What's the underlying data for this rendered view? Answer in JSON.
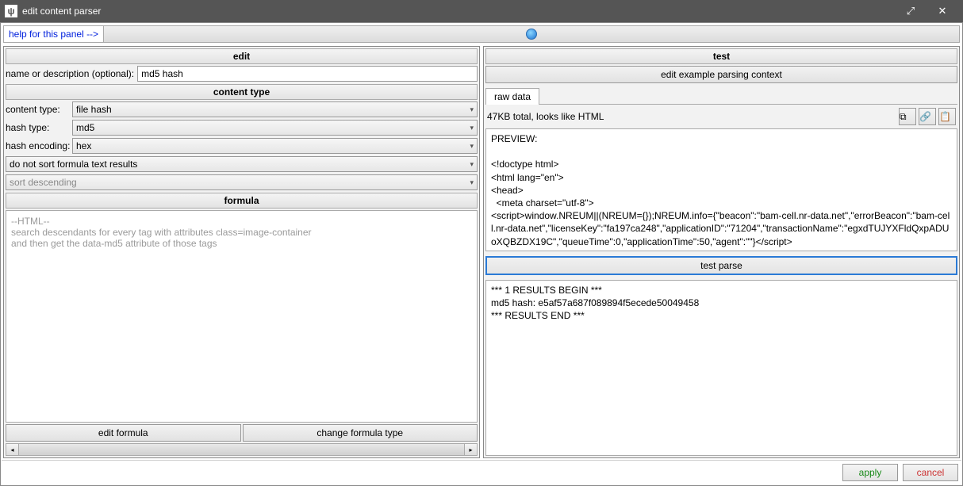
{
  "window": {
    "title": "edit content parser",
    "icon_glyph": "ψ"
  },
  "help": {
    "link_text": "help for this panel -->"
  },
  "left": {
    "title": "edit",
    "name_label": "name or description (optional):",
    "name_value": "md5 hash",
    "content_type_title": "content type",
    "content_type_label": "content type:",
    "content_type_value": "file hash",
    "hash_type_label": "hash type:",
    "hash_type_value": "md5",
    "hash_encoding_label": "hash encoding:",
    "hash_encoding_value": "hex",
    "sort_option": "do not sort formula text results",
    "sort_direction": "sort descending",
    "formula_title": "formula",
    "formula_text": "--HTML--\nsearch descendants for every tag with attributes class=image-container\nand then get the data-md5 attribute of those tags",
    "edit_formula_btn": "edit formula",
    "change_formula_type_btn": "change formula type"
  },
  "right": {
    "title": "test",
    "edit_context_btn": "edit example parsing context",
    "tab_raw_data": "raw data",
    "info_line": "47KB total, looks like HTML",
    "preview_text": "PREVIEW:\n\n<!doctype html>\n<html lang=\"en\">\n<head>\n  <meta charset=\"utf-8\">\n<script>window.NREUM||(NREUM={});NREUM.info={\"beacon\":\"bam-cell.nr-data.net\",\"errorBeacon\":\"bam-cell.nr-data.net\",\"licenseKey\":\"fa197ca248\",\"applicationID\":\"71204\",\"transactionName\":\"egxdTUJYXFldQxpADUoXQBZDX19C\",\"queueTime\":0,\"applicationTime\":50,\"agent\":\"\"}</script>\n<script>(window.NREUM||(NREUM={})).loader_config={licenseKey:\"fa197ca248\",applicationID:\"71204\"};window.NREUM||(NREUM={}),__nr_require=function(e,t,n){function r(n){if(!t[n]){var i=t[n]={exports:{}};e[n]",
    "test_parse_btn": "test parse",
    "results_text": "*** 1 RESULTS BEGIN ***\nmd5 hash: e5af57a687f089894f5ecede50049458\n*** RESULTS END ***"
  },
  "footer": {
    "apply": "apply",
    "cancel": "cancel"
  }
}
